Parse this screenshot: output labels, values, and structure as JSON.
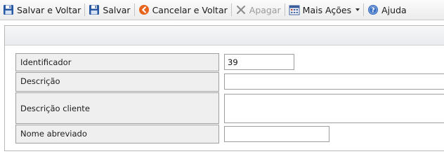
{
  "toolbar": {
    "items": [
      {
        "label": "Salvar e Voltar",
        "icon": "floppy-disk-icon",
        "enabled": true
      },
      {
        "label": "Salvar",
        "icon": "floppy-disk-icon",
        "enabled": true
      },
      {
        "label": "Cancelar e Voltar",
        "icon": "cancel-back-icon",
        "enabled": true
      },
      {
        "label": "Apagar",
        "icon": "x-delete-icon",
        "enabled": false
      },
      {
        "label": "Mais Ações",
        "icon": "calendar-actions-icon",
        "enabled": true,
        "dropdown": true
      },
      {
        "label": "Ajuda",
        "icon": "help-icon",
        "enabled": true
      }
    ]
  },
  "form": {
    "identificador": {
      "label": "Identificador",
      "value": "39"
    },
    "descricao": {
      "label": "Descrição",
      "value": ""
    },
    "descricao_cliente": {
      "label": "Descrição cliente",
      "value": ""
    },
    "nome_abreviado": {
      "label": "Nome abreviado",
      "value": ""
    }
  },
  "colors": {
    "toolbar_bg": "#f2f2f2",
    "label_bg": "#efefef",
    "cancel_orange": "#e8631c",
    "help_blue": "#3a6fc4",
    "save_blue": "#1f4f9a"
  }
}
